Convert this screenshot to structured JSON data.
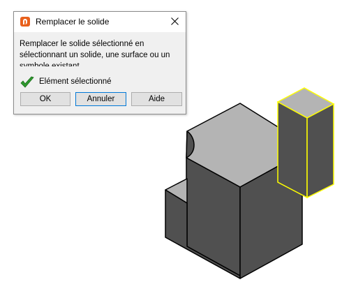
{
  "dialog": {
    "title": "Remplacer le solide",
    "message_lines": [
      "Remplacer le solide sélectionné en",
      "sélectionnant un solide, une surface ou un",
      "symbole existant."
    ],
    "status": "Elément sélectionné",
    "buttons": {
      "ok": "OK",
      "cancel": "Annuler",
      "help": "Aide"
    }
  },
  "colors": {
    "app_icon": "#e8601c",
    "check": "#2e9a2e",
    "selection_highlight": "#ffff00",
    "top_face": "#b4b4b4",
    "side_face": "#505050",
    "edge": "#000000"
  },
  "icons": {
    "app": "app-icon",
    "close": "close-icon",
    "status": "check-icon"
  }
}
